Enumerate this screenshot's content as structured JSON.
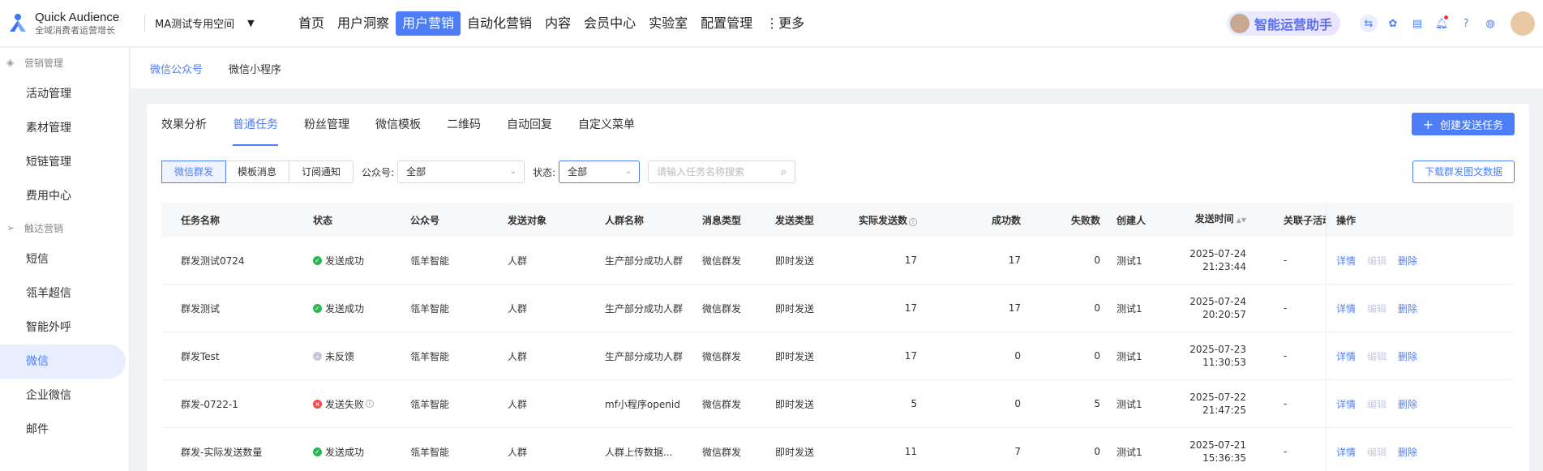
{
  "header": {
    "logo_title": "Quick Audience",
    "logo_subtitle": "全域消费者运营增长",
    "space": "MA测试专用空间",
    "nav": [
      "首页",
      "用户洞察",
      "用户营销",
      "自动化营销",
      "内容",
      "会员中心",
      "实验室",
      "配置管理",
      "⋮更多"
    ],
    "active_nav": "用户营销",
    "assistant": "智能运营助手"
  },
  "sidebar": {
    "groups": [
      {
        "label": "营销管理",
        "icon": "layers-icon",
        "items": [
          "活动管理",
          "素材管理",
          "短链管理",
          "费用中心"
        ]
      },
      {
        "label": "触达营销",
        "icon": "send-icon",
        "items": [
          "短信",
          "瓴羊超信",
          "智能外呼",
          "微信",
          "企业微信",
          "邮件"
        ]
      }
    ],
    "active": "微信"
  },
  "subtabs": {
    "items": [
      "微信公众号",
      "微信小程序"
    ],
    "active": "微信公众号"
  },
  "tabs": {
    "items": [
      "效果分析",
      "普通任务",
      "粉丝管理",
      "微信模板",
      "二维码",
      "自动回复",
      "自定义菜单"
    ],
    "active": "普通任务"
  },
  "create_button": "创建发送任务",
  "filters": {
    "segments": [
      "微信群发",
      "模板消息",
      "订阅通知"
    ],
    "active_segment": "微信群发",
    "account_label": "公众号:",
    "account_value": "全部",
    "status_label": "状态:",
    "status_value": "全部",
    "search_placeholder": "请输入任务名称搜索"
  },
  "download_button": "下载群发图文数据",
  "table": {
    "columns": [
      "任务名称",
      "状态",
      "公众号",
      "发送对象",
      "人群名称",
      "消息类型",
      "发送类型",
      "实际发送数",
      "成功数",
      "失败数",
      "创建人",
      "发送时间",
      "关联子活动",
      "操作"
    ],
    "rows": [
      {
        "name": "群发测试0724",
        "status": "发送成功",
        "status_type": "ok",
        "account": "瓴羊智能",
        "target": "人群",
        "crowd": "生产部分成功人群",
        "msg_type": "微信群发",
        "send_type": "即时发送",
        "actual": "17",
        "success": "17",
        "fail": "0",
        "creator": "测试1",
        "date": "2025-07-24",
        "time": "21:23:44",
        "sub": "-"
      },
      {
        "name": "群发测试",
        "status": "发送成功",
        "status_type": "ok",
        "account": "瓴羊智能",
        "target": "人群",
        "crowd": "生产部分成功人群",
        "msg_type": "微信群发",
        "send_type": "即时发送",
        "actual": "17",
        "success": "17",
        "fail": "0",
        "creator": "测试1",
        "date": "2025-07-24",
        "time": "20:20:57",
        "sub": "-"
      },
      {
        "name": "群发Test",
        "status": "未反馈",
        "status_type": "none",
        "account": "瓴羊智能",
        "target": "人群",
        "crowd": "生产部分成功人群",
        "msg_type": "微信群发",
        "send_type": "即时发送",
        "actual": "17",
        "success": "0",
        "fail": "0",
        "creator": "测试1",
        "date": "2025-07-23",
        "time": "11:30:53",
        "sub": "-"
      },
      {
        "name": "群发-0722-1",
        "status": "发送失败",
        "status_type": "fail",
        "account": "瓴羊智能",
        "target": "人群",
        "crowd": "mf小程序openid",
        "msg_type": "微信群发",
        "send_type": "即时发送",
        "actual": "5",
        "success": "0",
        "fail": "5",
        "creator": "测试1",
        "date": "2025-07-22",
        "time": "21:47:25",
        "sub": "-"
      },
      {
        "name": "群发-实际发送数量",
        "status": "发送成功",
        "status_type": "ok",
        "account": "瓴羊智能",
        "target": "人群",
        "crowd": "人群上传数据...",
        "msg_type": "微信群发",
        "send_type": "即时发送",
        "actual": "11",
        "success": "7",
        "fail": "0",
        "creator": "测试1",
        "date": "2025-07-21",
        "time": "15:36:35",
        "sub": "-"
      }
    ],
    "actions": [
      "详情",
      "编辑",
      "删除"
    ]
  },
  "colors": {
    "accent": "#4e7ef7",
    "success": "#2ab84e",
    "fail": "#f04b4b",
    "pending": "#c6c8d4"
  }
}
